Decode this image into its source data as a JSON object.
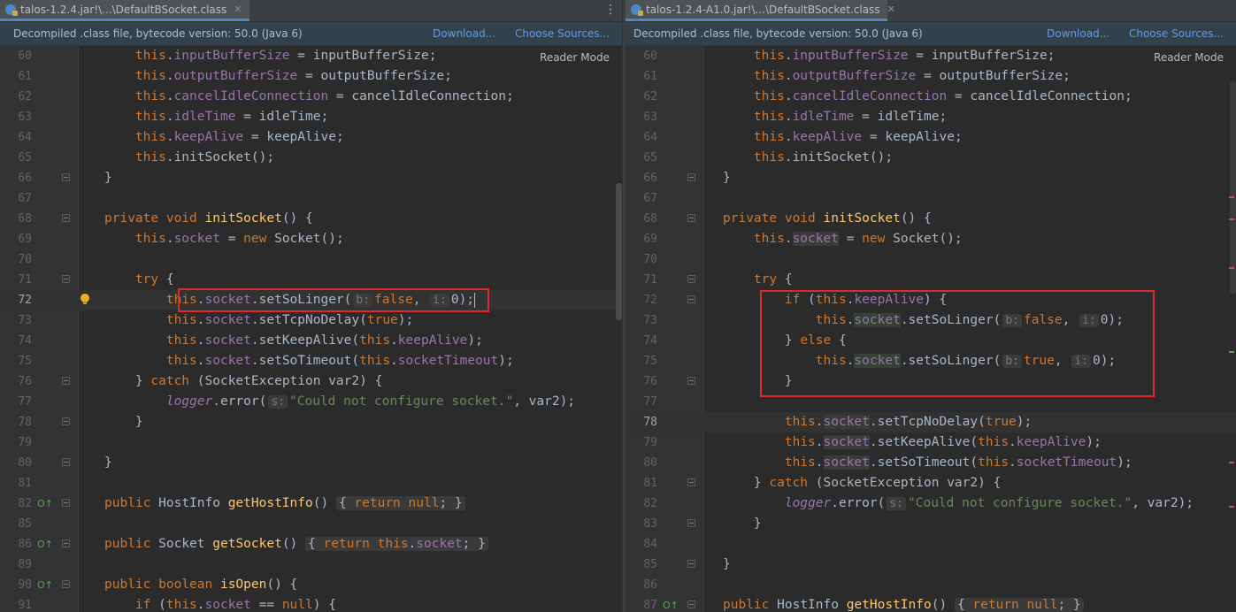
{
  "left": {
    "tab_title": "talos-1.2.4.jar!\\...\\DefaultBSocket.class",
    "notice": "Decompiled .class file, bytecode version: 50.0 (Java 6)",
    "download_link": "Download...",
    "sources_link": "Choose Sources...",
    "reader_mode": "Reader Mode",
    "line_numbers": [
      "60",
      "61",
      "62",
      "63",
      "64",
      "65",
      "66",
      "67",
      "68",
      "69",
      "70",
      "71",
      "72",
      "73",
      "74",
      "75",
      "76",
      "77",
      "78",
      "79",
      "80",
      "81",
      "82",
      "85",
      "86",
      "89",
      "90",
      "91"
    ]
  },
  "right": {
    "tab_title": "talos-1.2.4-A1.0.jar!\\...\\DefaultBSocket.class",
    "notice": "Decompiled .class file, bytecode version: 50.0 (Java 6)",
    "download_link": "Download...",
    "sources_link": "Choose Sources...",
    "reader_mode": "Reader Mode",
    "line_numbers": [
      "60",
      "61",
      "62",
      "63",
      "64",
      "65",
      "66",
      "67",
      "68",
      "69",
      "70",
      "71",
      "72",
      "73",
      "74",
      "75",
      "76",
      "77",
      "78",
      "79",
      "80",
      "81",
      "82",
      "83",
      "84",
      "85",
      "86",
      "87"
    ]
  },
  "colors": {
    "background": "#2b2b2b",
    "keyword": "#cc7832",
    "field": "#9876aa",
    "method": "#ffc66d",
    "string": "#6a8759",
    "highlight_box": "#e0292b"
  },
  "code": {
    "this": "this",
    "new": "new",
    "try": "try",
    "catch": "catch",
    "private": "private",
    "public": "public",
    "void": "void",
    "boolean": "boolean",
    "return": "return",
    "null": "null",
    "if": "if",
    "else": "else",
    "true": "true",
    "false": "false",
    "inputBufferSize": "inputBufferSize",
    "outputBufferSize": "outputBufferSize",
    "cancelIdleConnection": "cancelIdleConnection",
    "idleTime": "idleTime",
    "keepAlive": "keepAlive",
    "socket": "socket",
    "socketTimeout": "socketTimeout",
    "logger": "logger",
    "initSocket": "initSocket",
    "getHostInfo": "getHostInfo",
    "getSocket": "getSocket",
    "isOpen": "isOpen",
    "Socket": "Socket",
    "HostInfo": "HostInfo",
    "SocketException": "SocketException",
    "var2": "var2",
    "setSoLinger": "setSoLinger",
    "setTcpNoDelay": "setTcpNoDelay",
    "setKeepAlive": "setKeepAlive",
    "setSoTimeout": "setSoTimeout",
    "error": "error",
    "hint_b": "b:",
    "hint_i": "i:",
    "hint_s": "s:",
    "zero": "0",
    "message": "\"Could not configure socket.\""
  }
}
